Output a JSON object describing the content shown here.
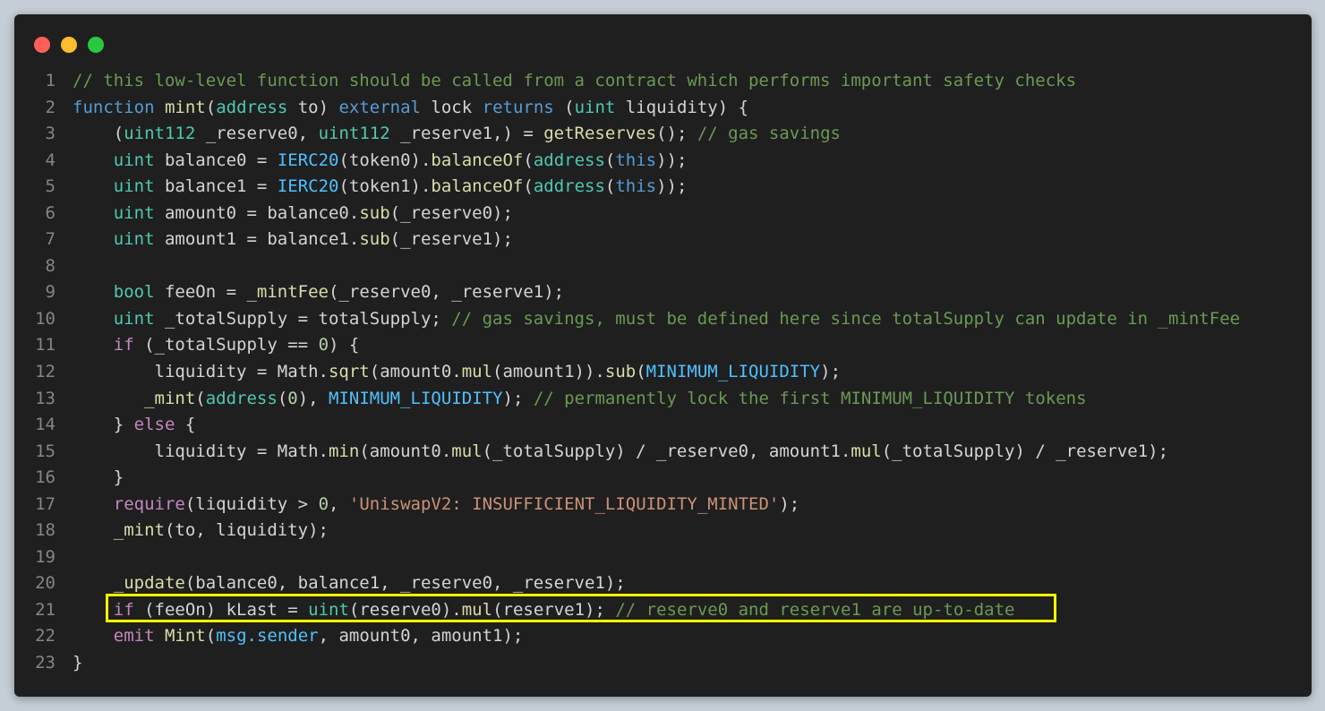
{
  "window": {
    "controls": [
      "close",
      "minimize",
      "maximize"
    ]
  },
  "lines": [
    {
      "n": "1",
      "tokens": [
        {
          "c": "cm",
          "t": "// this low-level function should be called from a contract which performs important safety checks"
        }
      ]
    },
    {
      "n": "2",
      "tokens": [
        {
          "c": "kw",
          "t": "function"
        },
        {
          "c": "pl",
          "t": " "
        },
        {
          "c": "fn",
          "t": "mint"
        },
        {
          "c": "pl",
          "t": "("
        },
        {
          "c": "ty",
          "t": "address"
        },
        {
          "c": "pl",
          "t": " to) "
        },
        {
          "c": "kw",
          "t": "external"
        },
        {
          "c": "pl",
          "t": " lock "
        },
        {
          "c": "kw",
          "t": "returns"
        },
        {
          "c": "pl",
          "t": " ("
        },
        {
          "c": "ty",
          "t": "uint"
        },
        {
          "c": "pl",
          "t": " liquidity) {"
        }
      ]
    },
    {
      "n": "3",
      "tokens": [
        {
          "c": "pl",
          "t": "    ("
        },
        {
          "c": "ty",
          "t": "uint112"
        },
        {
          "c": "pl",
          "t": " _reserve0, "
        },
        {
          "c": "ty",
          "t": "uint112"
        },
        {
          "c": "pl",
          "t": " _reserve1,) = "
        },
        {
          "c": "fn",
          "t": "getReserves"
        },
        {
          "c": "pl",
          "t": "(); "
        },
        {
          "c": "cm",
          "t": "// gas savings"
        }
      ]
    },
    {
      "n": "4",
      "tokens": [
        {
          "c": "pl",
          "t": "    "
        },
        {
          "c": "ty",
          "t": "uint"
        },
        {
          "c": "pl",
          "t": " balance0 = "
        },
        {
          "c": "const",
          "t": "IERC20"
        },
        {
          "c": "pl",
          "t": "(token0)."
        },
        {
          "c": "fn",
          "t": "balanceOf"
        },
        {
          "c": "pl",
          "t": "("
        },
        {
          "c": "ty",
          "t": "address"
        },
        {
          "c": "pl",
          "t": "("
        },
        {
          "c": "kw",
          "t": "this"
        },
        {
          "c": "pl",
          "t": "));"
        }
      ]
    },
    {
      "n": "5",
      "tokens": [
        {
          "c": "pl",
          "t": "    "
        },
        {
          "c": "ty",
          "t": "uint"
        },
        {
          "c": "pl",
          "t": " balance1 = "
        },
        {
          "c": "const",
          "t": "IERC20"
        },
        {
          "c": "pl",
          "t": "(token1)."
        },
        {
          "c": "fn",
          "t": "balanceOf"
        },
        {
          "c": "pl",
          "t": "("
        },
        {
          "c": "ty",
          "t": "address"
        },
        {
          "c": "pl",
          "t": "("
        },
        {
          "c": "kw",
          "t": "this"
        },
        {
          "c": "pl",
          "t": "));"
        }
      ]
    },
    {
      "n": "6",
      "tokens": [
        {
          "c": "pl",
          "t": "    "
        },
        {
          "c": "ty",
          "t": "uint"
        },
        {
          "c": "pl",
          "t": " amount0 = balance0."
        },
        {
          "c": "fn",
          "t": "sub"
        },
        {
          "c": "pl",
          "t": "(_reserve0);"
        }
      ]
    },
    {
      "n": "7",
      "tokens": [
        {
          "c": "pl",
          "t": "    "
        },
        {
          "c": "ty",
          "t": "uint"
        },
        {
          "c": "pl",
          "t": " amount1 = balance1."
        },
        {
          "c": "fn",
          "t": "sub"
        },
        {
          "c": "pl",
          "t": "(_reserve1);"
        }
      ]
    },
    {
      "n": "8",
      "tokens": []
    },
    {
      "n": "9",
      "tokens": [
        {
          "c": "pl",
          "t": "    "
        },
        {
          "c": "ty",
          "t": "bool"
        },
        {
          "c": "pl",
          "t": " feeOn = "
        },
        {
          "c": "fn",
          "t": "_mintFee"
        },
        {
          "c": "pl",
          "t": "(_reserve0, _reserve1);"
        }
      ]
    },
    {
      "n": "10",
      "tokens": [
        {
          "c": "pl",
          "t": "    "
        },
        {
          "c": "ty",
          "t": "uint"
        },
        {
          "c": "pl",
          "t": " _totalSupply = totalSupply; "
        },
        {
          "c": "cm",
          "t": "// gas savings, must be defined here since totalSupply can update in _mintFee"
        }
      ]
    },
    {
      "n": "11",
      "tokens": [
        {
          "c": "pl",
          "t": "    "
        },
        {
          "c": "ctl",
          "t": "if"
        },
        {
          "c": "pl",
          "t": " (_totalSupply == "
        },
        {
          "c": "num",
          "t": "0"
        },
        {
          "c": "pl",
          "t": ") {"
        }
      ]
    },
    {
      "n": "12",
      "tokens": [
        {
          "c": "pl",
          "t": "        liquidity = Math."
        },
        {
          "c": "fn",
          "t": "sqrt"
        },
        {
          "c": "pl",
          "t": "(amount0."
        },
        {
          "c": "fn",
          "t": "mul"
        },
        {
          "c": "pl",
          "t": "(amount1))."
        },
        {
          "c": "fn",
          "t": "sub"
        },
        {
          "c": "pl",
          "t": "("
        },
        {
          "c": "const",
          "t": "MINIMUM_LIQUIDITY"
        },
        {
          "c": "pl",
          "t": ");"
        }
      ]
    },
    {
      "n": "13",
      "tokens": [
        {
          "c": "pl",
          "t": "       "
        },
        {
          "c": "fn",
          "t": "_mint"
        },
        {
          "c": "pl",
          "t": "("
        },
        {
          "c": "ty",
          "t": "address"
        },
        {
          "c": "pl",
          "t": "("
        },
        {
          "c": "num",
          "t": "0"
        },
        {
          "c": "pl",
          "t": "), "
        },
        {
          "c": "const",
          "t": "MINIMUM_LIQUIDITY"
        },
        {
          "c": "pl",
          "t": "); "
        },
        {
          "c": "cm",
          "t": "// permanently lock the first MINIMUM_LIQUIDITY tokens"
        }
      ]
    },
    {
      "n": "14",
      "tokens": [
        {
          "c": "pl",
          "t": "    } "
        },
        {
          "c": "ctl",
          "t": "else"
        },
        {
          "c": "pl",
          "t": " {"
        }
      ]
    },
    {
      "n": "15",
      "tokens": [
        {
          "c": "pl",
          "t": "        liquidity = Math."
        },
        {
          "c": "fn",
          "t": "min"
        },
        {
          "c": "pl",
          "t": "(amount0."
        },
        {
          "c": "fn",
          "t": "mul"
        },
        {
          "c": "pl",
          "t": "(_totalSupply) / _reserve0, amount1."
        },
        {
          "c": "fn",
          "t": "mul"
        },
        {
          "c": "pl",
          "t": "(_totalSupply) / _reserve1);"
        }
      ]
    },
    {
      "n": "16",
      "tokens": [
        {
          "c": "pl",
          "t": "    }"
        }
      ]
    },
    {
      "n": "17",
      "tokens": [
        {
          "c": "pl",
          "t": "    "
        },
        {
          "c": "ctl",
          "t": "require"
        },
        {
          "c": "pl",
          "t": "(liquidity > "
        },
        {
          "c": "num",
          "t": "0"
        },
        {
          "c": "pl",
          "t": ", "
        },
        {
          "c": "str",
          "t": "'UniswapV2: INSUFFICIENT_LIQUIDITY_MINTED'"
        },
        {
          "c": "pl",
          "t": ");"
        }
      ]
    },
    {
      "n": "18",
      "tokens": [
        {
          "c": "pl",
          "t": "    "
        },
        {
          "c": "fn",
          "t": "_mint"
        },
        {
          "c": "pl",
          "t": "(to, liquidity);"
        }
      ]
    },
    {
      "n": "19",
      "tokens": []
    },
    {
      "n": "20",
      "tokens": [
        {
          "c": "pl",
          "t": "    "
        },
        {
          "c": "fn",
          "t": "_update"
        },
        {
          "c": "pl",
          "t": "(balance0, balance1, _reserve0, _reserve1);"
        }
      ]
    },
    {
      "n": "21",
      "tokens": [
        {
          "c": "pl",
          "t": "    "
        },
        {
          "c": "ctl",
          "t": "if"
        },
        {
          "c": "pl",
          "t": " (feeOn) kLast = "
        },
        {
          "c": "ty",
          "t": "uint"
        },
        {
          "c": "pl",
          "t": "(reserve0)."
        },
        {
          "c": "fn",
          "t": "mul"
        },
        {
          "c": "pl",
          "t": "(reserve1); "
        },
        {
          "c": "cm",
          "t": "// reserve0 and reserve1 are up-to-date"
        }
      ]
    },
    {
      "n": "22",
      "tokens": [
        {
          "c": "pl",
          "t": "    "
        },
        {
          "c": "ctl",
          "t": "emit"
        },
        {
          "c": "pl",
          "t": " "
        },
        {
          "c": "fn",
          "t": "Mint"
        },
        {
          "c": "pl",
          "t": "("
        },
        {
          "c": "const",
          "t": "msg.sender"
        },
        {
          "c": "pl",
          "t": ", amount0, amount1);"
        }
      ]
    },
    {
      "n": "23",
      "tokens": [
        {
          "c": "pl",
          "t": "}"
        }
      ]
    }
  ],
  "highlight": {
    "line": "21",
    "color": "#ffff00"
  }
}
